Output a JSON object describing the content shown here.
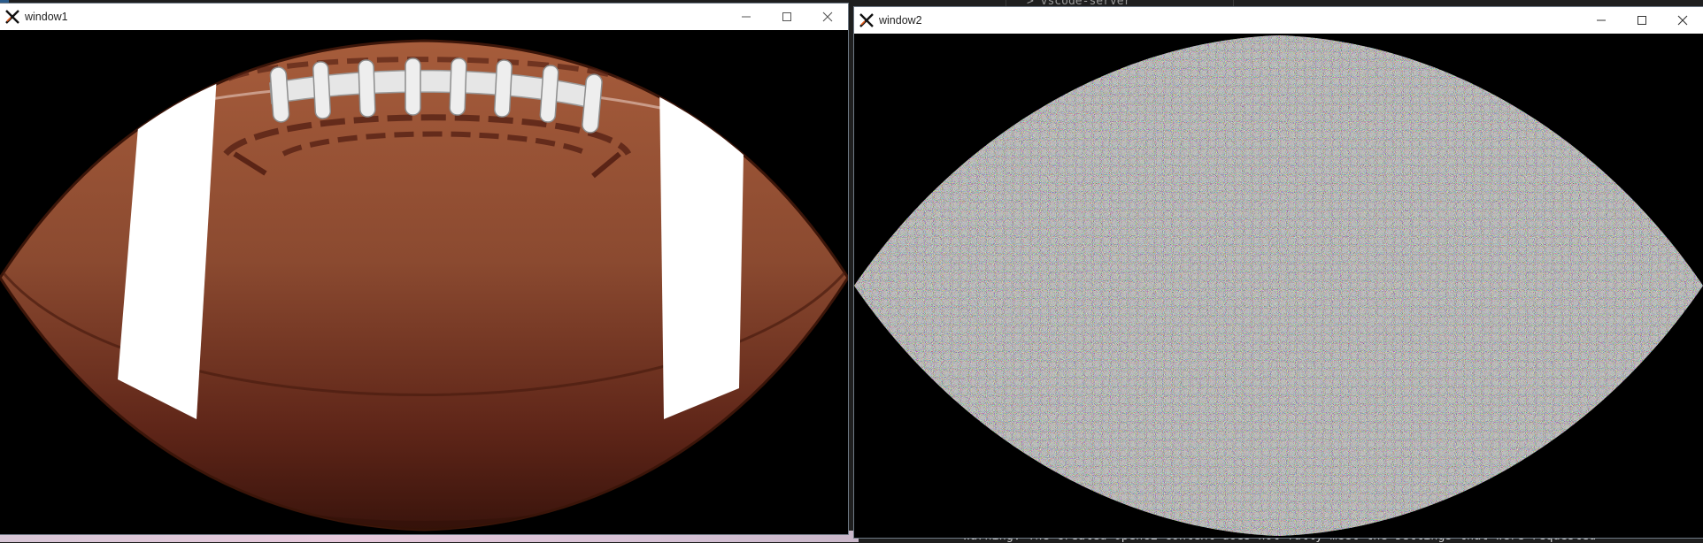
{
  "desktop": {
    "terminal_top_text": "> vscode-server",
    "terminal_bottom_text": "Warning: The created OpenGL context does not fully meet the settings that were requested"
  },
  "windows": [
    {
      "title": "window1",
      "content": "football-image",
      "icon": "x-window-icon"
    },
    {
      "title": "window2",
      "content": "noise-filled-football-shape",
      "icon": "x-window-icon"
    }
  ],
  "colors": {
    "ball_dark": "#4a1a10",
    "ball_mid": "#8a4a30",
    "ball_light": "#a25a3a",
    "stripe": "#ffffff",
    "lace": "#e6e6e6",
    "titlebar": "#ffffff"
  }
}
